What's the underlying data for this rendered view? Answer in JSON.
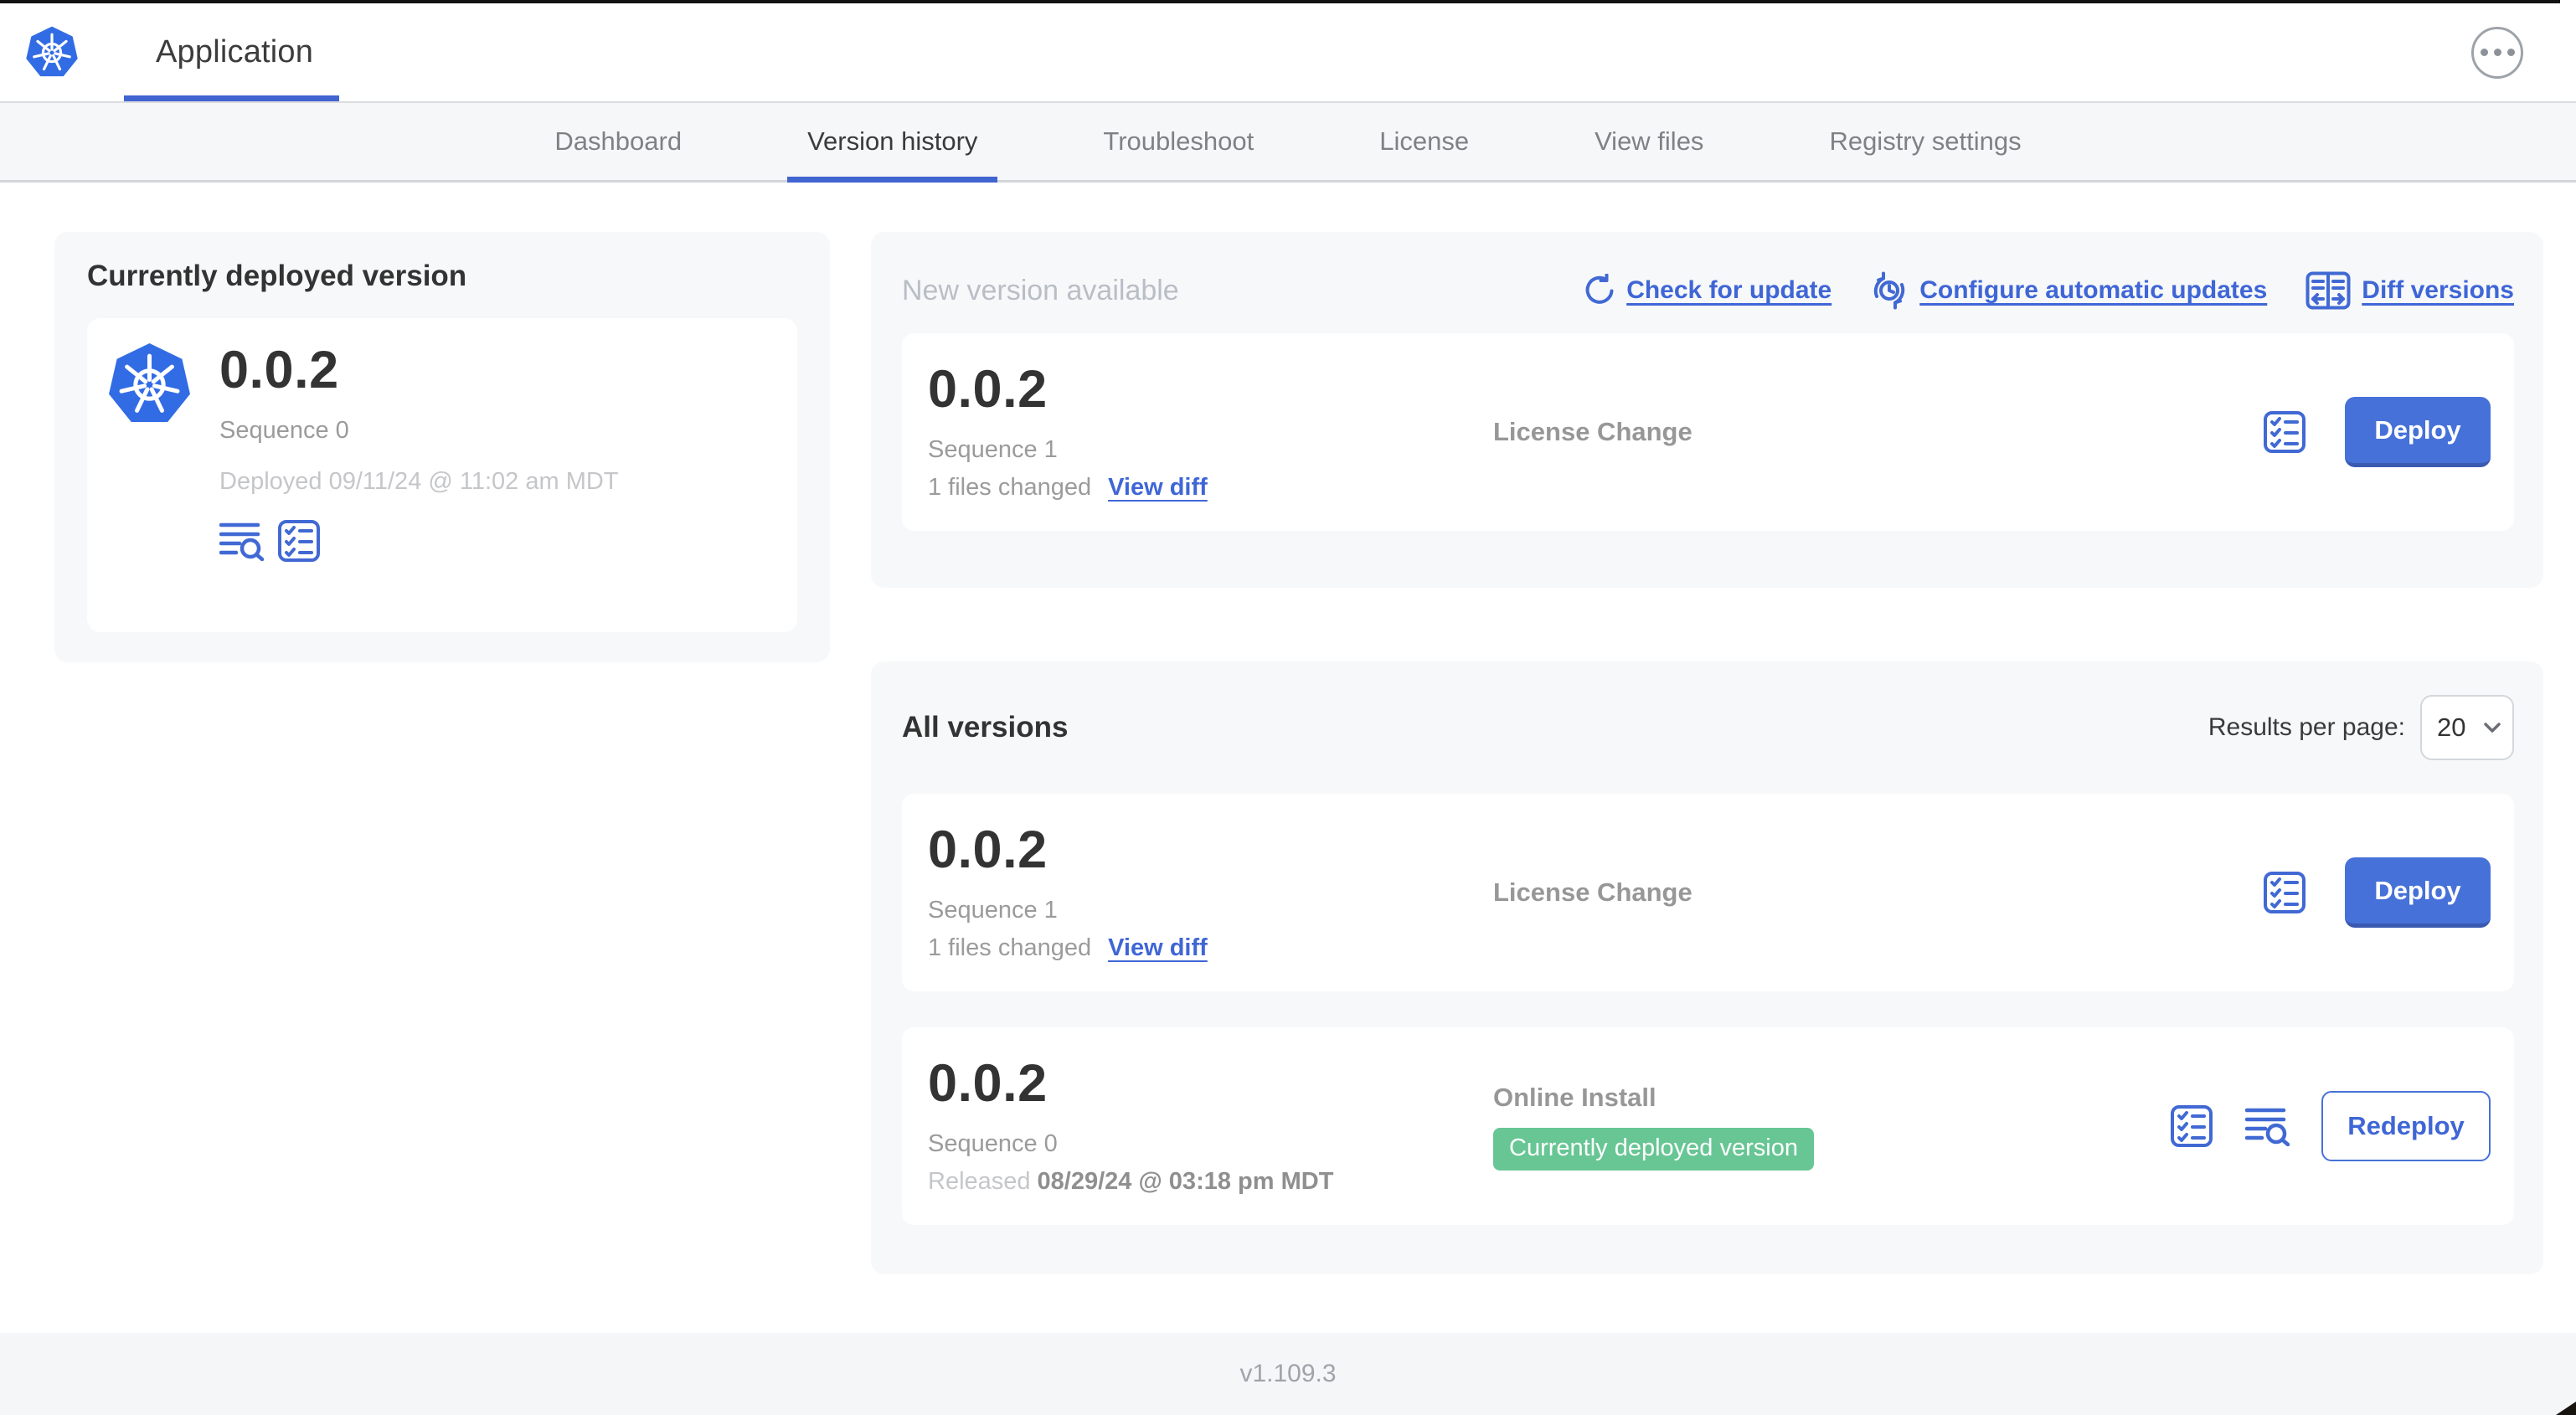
{
  "header": {
    "app_title": "Application"
  },
  "nav": {
    "tabs": [
      {
        "label": "Dashboard",
        "active": false
      },
      {
        "label": "Version history",
        "active": true
      },
      {
        "label": "Troubleshoot",
        "active": false
      },
      {
        "label": "License",
        "active": false
      },
      {
        "label": "View files",
        "active": false
      },
      {
        "label": "Registry settings",
        "active": false
      }
    ]
  },
  "deployed": {
    "title": "Currently deployed version",
    "version": "0.0.2",
    "sequence": "Sequence 0",
    "deployed_at": "Deployed 09/11/24 @ 11:02 am MDT"
  },
  "new_version": {
    "title": "New version available",
    "actions": {
      "check_for_update": "Check for update",
      "configure_auto": "Configure automatic updates",
      "diff_versions": "Diff versions"
    },
    "row": {
      "version": "0.0.2",
      "sequence": "Sequence 1",
      "files_changed": "1 files changed",
      "view_diff": "View diff",
      "source": "License Change",
      "deploy_label": "Deploy"
    }
  },
  "all_versions": {
    "title": "All versions",
    "results_per_page_label": "Results per page:",
    "results_per_page_value": "20",
    "rows": [
      {
        "version": "0.0.2",
        "sequence": "Sequence 1",
        "files_changed": "1 files changed",
        "view_diff": "View diff",
        "source": "License Change",
        "deploy_label": "Deploy"
      },
      {
        "version": "0.0.2",
        "sequence": "Sequence 0",
        "released_prefix": "Released",
        "released_date": "08/29/24 @ 03:18 pm MDT",
        "source": "Online Install",
        "badge": "Currently deployed version",
        "redeploy_label": "Redeploy"
      }
    ]
  },
  "footer": {
    "version": "v1.109.3"
  },
  "colors": {
    "primary_blue": "#4671d8",
    "link_blue": "#3f66d6",
    "k8s_blue": "#326ce5",
    "badge_green": "#67c694"
  }
}
